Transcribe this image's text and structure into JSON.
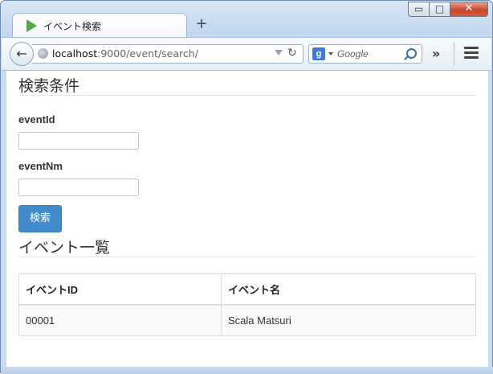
{
  "browser": {
    "tab_title": "イベント検索",
    "new_tab_label": "+",
    "window_buttons": {
      "minimize": "▭",
      "maximize": "□",
      "close": "✕"
    },
    "back_label": "←",
    "url_host": "localhost",
    "url_path": ":9000/event/search/",
    "reload_label": "↻",
    "search_engine_letter": "g",
    "search_placeholder": "Google",
    "overflow_label": "»"
  },
  "search": {
    "heading": "検索条件",
    "fields": [
      {
        "label": "eventId",
        "value": ""
      },
      {
        "label": "eventNm",
        "value": ""
      }
    ],
    "submit_label": "検索"
  },
  "list": {
    "heading": "イベント一覧",
    "columns": [
      "イベントID",
      "イベント名"
    ],
    "rows": [
      [
        "00001",
        "Scala Matsuri"
      ]
    ]
  }
}
